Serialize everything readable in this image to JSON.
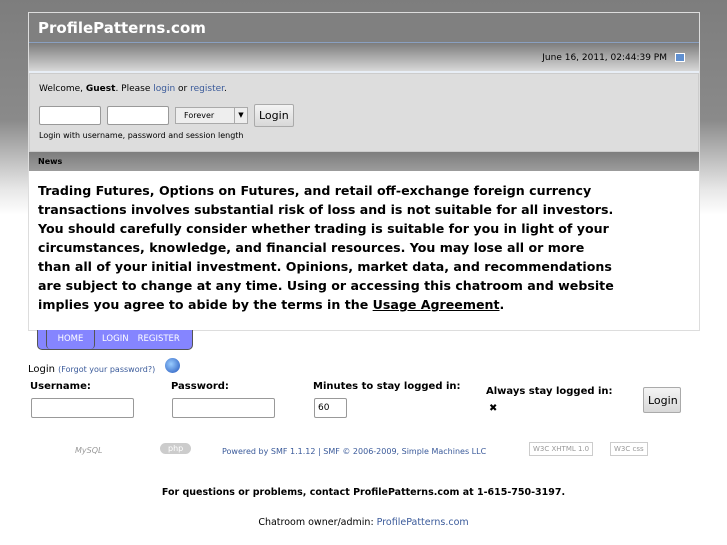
{
  "header": {
    "title": "ProfilePatterns.com",
    "datetime": "June 16, 2011, 02:44:39 PM"
  },
  "user": {
    "welcome": "Welcome, ",
    "guest": "Guest",
    "please": ". Please ",
    "login_link": "login",
    "or": " or ",
    "register_link": "register",
    "period": ".",
    "session_option": "Forever",
    "login_button": "Login",
    "hint": "Login with username, password and session length"
  },
  "news": {
    "title": "News",
    "body": "Trading Futures, Options on Futures, and retail off-exchange foreign currency transactions involves substantial risk of loss and is not suitable for all investors.  You should carefully consider whether trading is suitable for you in light of your circumstances, knowledge, and financial resources.  You may lose all or more than all of your initial investment. Opinions, market data, and recommendations are subject to change at any time.  Using or accessing this chatroom and website implies you agree to abide by the terms in the ",
    "link": "Usage Agreement",
    "end": "."
  },
  "menu": {
    "home": "HOME",
    "login": "LOGIN",
    "register": "REGISTER"
  },
  "login_form": {
    "title": "Login",
    "forgot": "(Forgot your password?)",
    "username_label": "Username:",
    "password_label": "Password:",
    "minutes_label": "Minutes to stay logged in:",
    "minutes_value": "60",
    "always_label": "Always stay logged in:",
    "checkbox_mark": "✖",
    "button": "Login"
  },
  "footer": {
    "mysql": "MySQL",
    "php": "php",
    "powered": "Powered by SMF 1.1.12 | SMF © 2006-2009, Simple Machines LLC",
    "xhtml": "W3C XHTML 1.0",
    "css": "W3C css",
    "contact": "For questions or problems, contact ProfilePatterns.com at 1-615-750-3197.",
    "owner_label": "Chatroom owner/admin: ",
    "owner_link": "ProfilePatterns.com"
  }
}
